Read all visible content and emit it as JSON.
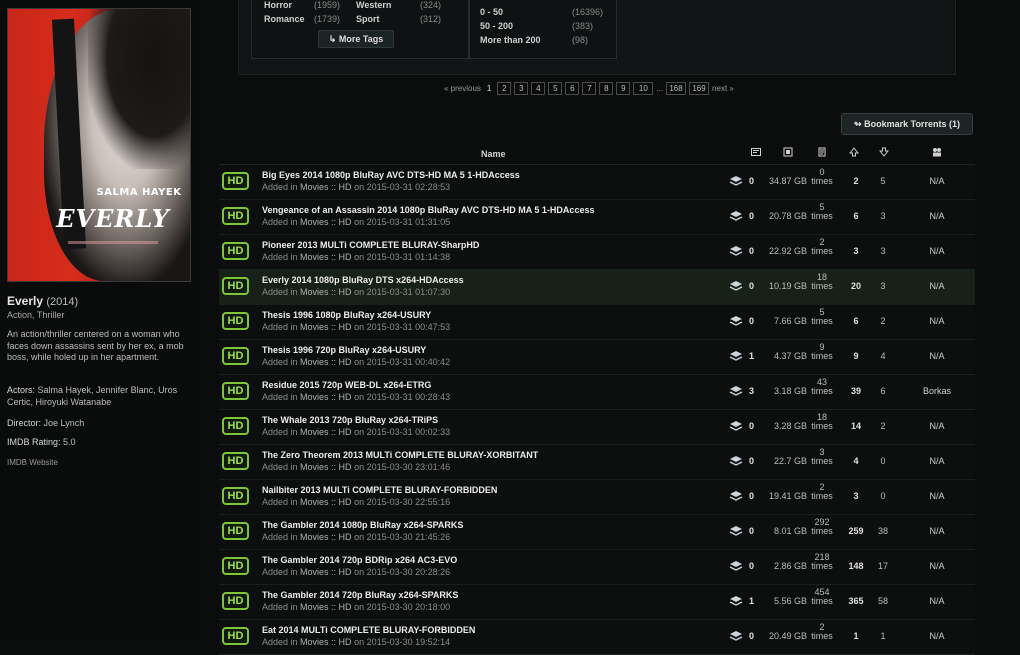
{
  "movie": {
    "poster": {
      "actor_text": "SALMA HAYEK",
      "logo_text": "EVERLY"
    },
    "title": "Everly",
    "year": "(2014)",
    "genres": "Action, Thriller",
    "synopsis": "An action/thriller centered on a woman who faces down assassins sent by her ex, a mob boss, while holed up in her apartment.",
    "actors_label": "Actors:",
    "actors": "Salma Hayek, Jennifer Blanc, Uros Certic, Hiroyuki Watanabe",
    "director_label": "Director:",
    "director": "Joe Lynch",
    "rating_label": "IMDB Rating:",
    "rating": "5.0",
    "imdb_link": "IMDB Website"
  },
  "filters": {
    "tags": [
      {
        "name": "Horror",
        "count": "(1959)"
      },
      {
        "name": "Western",
        "count": "(324)"
      },
      {
        "name": "Romance",
        "count": "(1739)"
      },
      {
        "name": "Sport",
        "count": "(312)"
      }
    ],
    "more_tags": "More Tags",
    "sizes": [
      {
        "name": "0 - 50",
        "count": "(16396)"
      },
      {
        "name": "50 - 200",
        "count": "(383)"
      },
      {
        "name": "More than 200",
        "count": "(98)"
      }
    ]
  },
  "pagination": {
    "previous": "« previous",
    "current": "1",
    "pages": [
      "2",
      "3",
      "4",
      "5",
      "6",
      "7",
      "8",
      "9",
      "10"
    ],
    "ellipsis": "...",
    "last_pages": [
      "168",
      "169"
    ],
    "next": "next »"
  },
  "bookmark_button": "Bookmark Torrents (1)",
  "table": {
    "header_name": "Name",
    "badge": "HD",
    "rows": [
      {
        "name": "Big Eyes 2014 1080p BluRay AVC DTS-HD MA 5 1-HDAccess",
        "added": "Added in",
        "cat": "Movies :: HD",
        "on": "on 2015-03-31 02:28:53",
        "comments": "0",
        "size": "34.87 GB",
        "times": "0",
        "times_word": "times",
        "seeders": "2",
        "leechers": "5",
        "uploader": "N/A"
      },
      {
        "name": "Vengeance of an Assassin 2014 1080p BluRay AVC DTS-HD MA 5 1-HDAccess",
        "added": "Added in",
        "cat": "Movies :: HD",
        "on": "on 2015-03-31 01:31:05",
        "comments": "0",
        "size": "20.78 GB",
        "times": "5",
        "times_word": "times",
        "seeders": "6",
        "leechers": "3",
        "uploader": "N/A"
      },
      {
        "name": "Pioneer 2013 MULTi COMPLETE BLURAY-SharpHD",
        "added": "Added in",
        "cat": "Movies :: HD",
        "on": "on 2015-03-31 01:14:38",
        "comments": "0",
        "size": "22.92 GB",
        "times": "2",
        "times_word": "times",
        "seeders": "3",
        "leechers": "3",
        "uploader": "N/A"
      },
      {
        "name": "Everly 2014 1080p BluRay DTS x264-HDAccess",
        "added": "Added in",
        "cat": "Movies :: HD",
        "on": "on 2015-03-31 01:07:30",
        "comments": "0",
        "size": "10.19 GB",
        "times": "18",
        "times_word": "times",
        "seeders": "20",
        "leechers": "3",
        "uploader": "N/A"
      },
      {
        "name": "Thesis 1996 1080p BluRay x264-USURY",
        "added": "Added in",
        "cat": "Movies :: HD",
        "on": "on 2015-03-31 00:47:53",
        "comments": "0",
        "size": "7.66 GB",
        "times": "5",
        "times_word": "times",
        "seeders": "6",
        "leechers": "2",
        "uploader": "N/A"
      },
      {
        "name": "Thesis 1996 720p BluRay x264-USURY",
        "added": "Added in",
        "cat": "Movies :: HD",
        "on": "on 2015-03-31 00:40:42",
        "comments": "1",
        "size": "4.37 GB",
        "times": "9",
        "times_word": "times",
        "seeders": "9",
        "leechers": "4",
        "uploader": "N/A"
      },
      {
        "name": "Residue 2015 720p WEB-DL x264-ETRG",
        "added": "Added in",
        "cat": "Movies :: HD",
        "on": "on 2015-03-31 00:28:43",
        "comments": "3",
        "size": "3.18 GB",
        "times": "43",
        "times_word": "times",
        "seeders": "39",
        "leechers": "6",
        "uploader": "Borkas"
      },
      {
        "name": "The Whale 2013 720p BluRay x264-TRiPS",
        "added": "Added in",
        "cat": "Movies :: HD",
        "on": "on 2015-03-31 00:02:33",
        "comments": "0",
        "size": "3.28 GB",
        "times": "18",
        "times_word": "times",
        "seeders": "14",
        "leechers": "2",
        "uploader": "N/A"
      },
      {
        "name": "The Zero Theorem 2013 MULTi COMPLETE BLURAY-XORBITANT",
        "added": "Added in",
        "cat": "Movies :: HD",
        "on": "on 2015-03-30 23:01:46",
        "comments": "0",
        "size": "22.7 GB",
        "times": "3",
        "times_word": "times",
        "seeders": "4",
        "leechers": "0",
        "uploader": "N/A"
      },
      {
        "name": "Nailbiter 2013 MULTi COMPLETE BLURAY-FORBIDDEN",
        "added": "Added in",
        "cat": "Movies :: HD",
        "on": "on 2015-03-30 22:55:16",
        "comments": "0",
        "size": "19.41 GB",
        "times": "2",
        "times_word": "times",
        "seeders": "3",
        "leechers": "0",
        "uploader": "N/A"
      },
      {
        "name": "The Gambler 2014 1080p BluRay x264-SPARKS",
        "added": "Added in",
        "cat": "Movies :: HD",
        "on": "on 2015-03-30 21:45:26",
        "comments": "0",
        "size": "8.01 GB",
        "times": "292",
        "times_word": "times",
        "seeders": "259",
        "leechers": "38",
        "uploader": "N/A"
      },
      {
        "name": "The Gambler 2014 720p BDRip x264 AC3-EVO",
        "added": "Added in",
        "cat": "Movies :: HD",
        "on": "on 2015-03-30 20:28:26",
        "comments": "0",
        "size": "2.86 GB",
        "times": "218",
        "times_word": "times",
        "seeders": "148",
        "leechers": "17",
        "uploader": "N/A"
      },
      {
        "name": "The Gambler 2014 720p BluRay x264-SPARKS",
        "added": "Added in",
        "cat": "Movies :: HD",
        "on": "on 2015-03-30 20:18:00",
        "comments": "1",
        "size": "5.56 GB",
        "times": "454",
        "times_word": "times",
        "seeders": "365",
        "leechers": "58",
        "uploader": "N/A"
      },
      {
        "name": "Eat 2014 MULTi COMPLETE BLURAY-FORBIDDEN",
        "added": "Added in",
        "cat": "Movies :: HD",
        "on": "on 2015-03-30 19:52:14",
        "comments": "0",
        "size": "20.49 GB",
        "times": "2",
        "times_word": "times",
        "seeders": "1",
        "leechers": "1",
        "uploader": "N/A"
      }
    ]
  },
  "colors": {
    "hd_badge_border": "#7ec53a",
    "highlight_row": "#172117",
    "background": "#0b0d0d"
  }
}
